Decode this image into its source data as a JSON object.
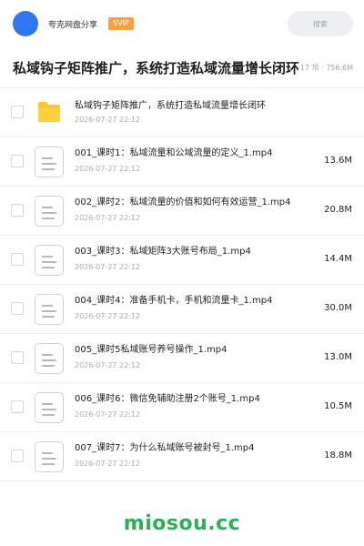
{
  "header": {
    "site_name": "夸克网盘分享",
    "badge": "SVIP",
    "search_placeholder": "搜索",
    "avatar_color": "#2f76f0"
  },
  "share": {
    "title": "私域钩子矩阵推广，系统打造私域流量增长闭环",
    "meta": "17 项 · 756.6M"
  },
  "files": [
    {
      "type": "folder",
      "name": "私域钩子矩阵推广，系统打造私域流量增长闭环",
      "date": "2026-07-27 22:12",
      "size": ""
    },
    {
      "type": "file",
      "name": "001_课时1：私域流量和公域流量的定义_1.mp4",
      "date": "2026-07-27 22:12",
      "size": "13.6M"
    },
    {
      "type": "file",
      "name": "002_课时2：私域流量的价值和如何有效运营_1.mp4",
      "date": "2026-07-27 22:12",
      "size": "20.8M"
    },
    {
      "type": "file",
      "name": "003_课时3：私域矩阵3大账号布局_1.mp4",
      "date": "2026-07-27 22:12",
      "size": "14.4M"
    },
    {
      "type": "file",
      "name": "004_课时4：准备手机卡，手机和流量卡_1.mp4",
      "date": "2026-07-27 22:12",
      "size": "30.0M"
    },
    {
      "type": "file",
      "name": "005_课时5私域账号养号操作_1.mp4",
      "date": "2026-07-27 22:12",
      "size": "13.0M"
    },
    {
      "type": "file",
      "name": "006_课时6：微信免辅助注册2个账号_1.mp4",
      "date": "2026-07-27 22:12",
      "size": "10.5M"
    },
    {
      "type": "file",
      "name": "007_课时7：为什么私域账号被封号_1.mp4",
      "date": "2026-07-27 22:12",
      "size": "18.8M"
    }
  ],
  "watermark": "miosou.cc",
  "colors": {
    "folder": "#fcc72c",
    "watermark": "#2fae59",
    "badge": "#f8a23c"
  }
}
